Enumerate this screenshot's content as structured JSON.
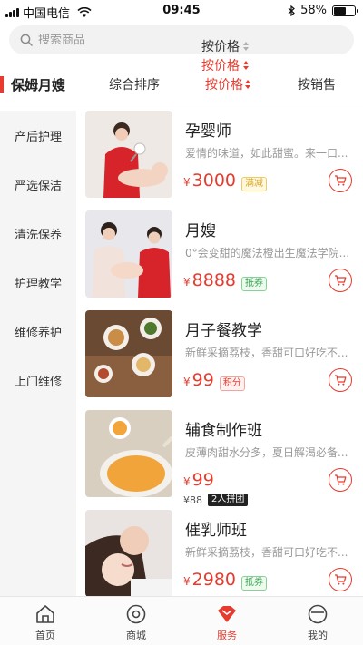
{
  "status_bar": {
    "carrier": "中国电信",
    "time": "09:45",
    "battery": "58%",
    "battery_level": 0.58
  },
  "search": {
    "placeholder": "搜索商品"
  },
  "price_menu": {
    "options": [
      "按价格",
      "按价格",
      "按价格"
    ]
  },
  "header": {
    "category_title": "保姆月嫂",
    "sort_tabs": [
      "综合排序",
      "按价格",
      "按销售"
    ]
  },
  "sidebar": {
    "items": [
      "产后护理",
      "严选保洁",
      "清洗保养",
      "护理教学",
      "维修养护",
      "上门维修"
    ]
  },
  "products": [
    {
      "title": "孕婴师",
      "desc": "爱情的味道，如此甜蜜。来一口...",
      "currency": "¥",
      "price": "3000",
      "tag": "满减",
      "tag_color": "yellow"
    },
    {
      "title": "月嫂",
      "desc": "0°会变甜的魔法橙出生魔法学院...",
      "currency": "¥",
      "price": "8888",
      "tag": "抵券",
      "tag_color": "green"
    },
    {
      "title": "月子餐教学",
      "desc": "新鲜采摘荔枝，香甜可口好吃不...",
      "currency": "¥",
      "price": "99",
      "tag": "积分",
      "tag_color": "red"
    },
    {
      "title": "辅食制作班",
      "desc": "皮薄肉甜水分多，夏日解渴必备...",
      "currency": "¥",
      "price": "99",
      "tag": "",
      "tag_color": "",
      "original_price": "¥88",
      "group_tag": "2人拼团"
    },
    {
      "title": "催乳师班",
      "desc": "新鲜采摘荔枝，香甜可口好吃不...",
      "currency": "¥",
      "price": "2980",
      "tag": "抵券",
      "tag_color": "green"
    }
  ],
  "tab_bar": {
    "items": [
      "首页",
      "商城",
      "服务",
      "我的"
    ],
    "active_index": 2
  },
  "colors": {
    "accent": "#e63b2e",
    "sidebar_bg": "#f5f5f5",
    "search_bg": "#f2f2f2"
  }
}
